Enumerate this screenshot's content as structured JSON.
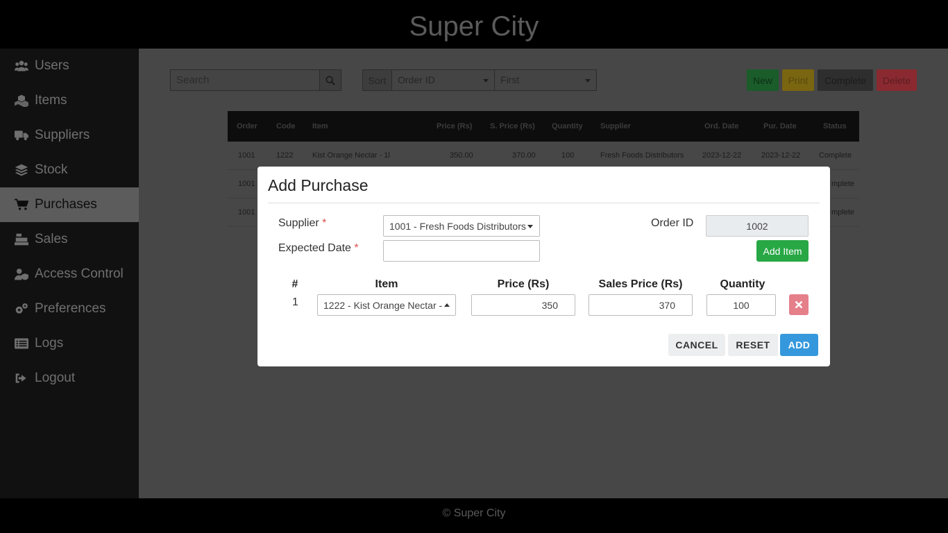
{
  "app": {
    "title": "Super City",
    "footer": "© Super City"
  },
  "sidebar": {
    "items": [
      {
        "label": "Users",
        "icon": "users-icon"
      },
      {
        "label": "Items",
        "icon": "cubes-icon"
      },
      {
        "label": "Suppliers",
        "icon": "truck-icon"
      },
      {
        "label": "Stock",
        "icon": "layers-icon"
      },
      {
        "label": "Purchases",
        "icon": "cart-icon",
        "active": true
      },
      {
        "label": "Sales",
        "icon": "cash-register-icon"
      },
      {
        "label": "Access Control",
        "icon": "user-shield-icon"
      },
      {
        "label": "Preferences",
        "icon": "gears-icon"
      },
      {
        "label": "Logs",
        "icon": "list-icon"
      },
      {
        "label": "Logout",
        "icon": "sign-out-icon"
      }
    ]
  },
  "toolbar": {
    "search_placeholder": "Search",
    "sort_label": "Sort",
    "sort_field": "Order ID",
    "sort_order": "First",
    "new_label": "New",
    "print_label": "Print",
    "complete_label": "Complete",
    "delete_label": "Delete",
    "colors": {
      "new": "#1a5c2a",
      "print": "#7a6510",
      "complete": "#2e2e2e",
      "delete": "#8a2a30"
    }
  },
  "table": {
    "headers": [
      "Order",
      "Code",
      "Item",
      "Price (Rs)",
      "S. Price (Rs)",
      "Quantity",
      "Supplier",
      "Ord. Date",
      "Pur. Date",
      "Status"
    ],
    "rows": [
      [
        "1001",
        "1222",
        "Kist Orange Nectar - 1l",
        "350.00",
        "370.00",
        "100",
        "Fresh Foods Distributors",
        "2023-12-22",
        "2023-12-22",
        "Complete"
      ],
      [
        "1001",
        "",
        "",
        "",
        "",
        "",
        "",
        "",
        "",
        "mplete"
      ],
      [
        "1001",
        "",
        "",
        "",
        "",
        "",
        "",
        "",
        "",
        "mplete"
      ]
    ]
  },
  "modal": {
    "title": "Add Purchase",
    "supplier_label": "Supplier",
    "supplier_value": "1001 - Fresh Foods Distributors",
    "expected_date_label": "Expected Date",
    "expected_date_value": "",
    "required_mark": "*",
    "order_id_label": "Order ID",
    "order_id_value": "1002",
    "add_item_label": "Add Item",
    "columns": {
      "num": "#",
      "item": "Item",
      "price": "Price (Rs)",
      "sales_price": "Sales Price (Rs)",
      "quantity": "Quantity"
    },
    "lines": [
      {
        "num": "1",
        "item": "1222 - Kist Orange Nectar -",
        "price": "350",
        "sales_price": "370",
        "quantity": "100"
      }
    ],
    "cancel_label": "CANCEL",
    "reset_label": "RESET",
    "add_label": "ADD",
    "colors": {
      "add": "#3598dc",
      "add_item": "#28a745",
      "remove": "#e57f8a"
    }
  }
}
